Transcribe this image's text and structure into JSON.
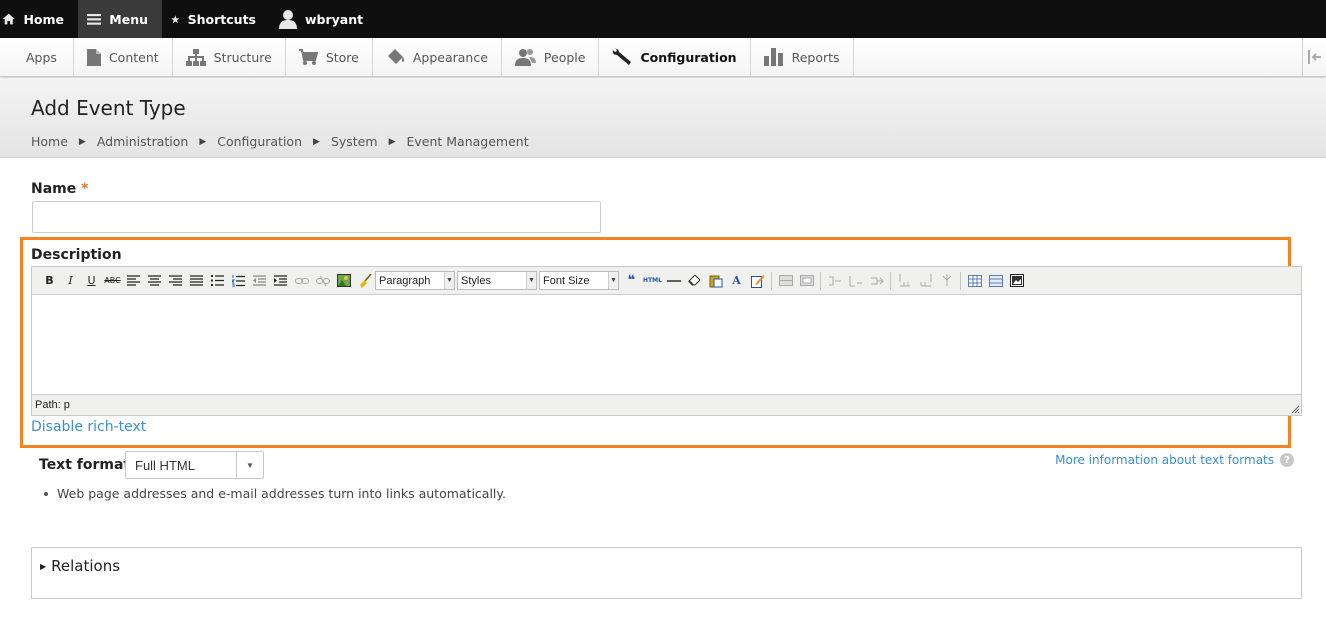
{
  "topbar": {
    "home": "Home",
    "menu": "Menu",
    "shortcuts": "Shortcuts",
    "user": "wbryant"
  },
  "tray": {
    "items": [
      {
        "label": "Apps",
        "icon": "none"
      },
      {
        "label": "Content",
        "icon": "document-icon"
      },
      {
        "label": "Structure",
        "icon": "sitemap-icon"
      },
      {
        "label": "Store",
        "icon": "cart-icon"
      },
      {
        "label": "Appearance",
        "icon": "paint-icon"
      },
      {
        "label": "People",
        "icon": "people-icon"
      },
      {
        "label": "Configuration",
        "icon": "wrench-icon",
        "active": true
      },
      {
        "label": "Reports",
        "icon": "bar-chart-icon"
      }
    ]
  },
  "header": {
    "title": "Add Event Type",
    "breadcrumb": [
      "Home",
      "Administration",
      "Configuration",
      "System",
      "Event Management"
    ],
    "separator": "▶"
  },
  "form": {
    "name_label": "Name",
    "required_mark": "*",
    "name_value": "",
    "description_label": "Description",
    "editor": {
      "format_select": "Paragraph",
      "styles_select": "Styles",
      "font_size_select": "Font Size",
      "path": "Path: p"
    },
    "disable_rich_text": "Disable rich-text",
    "text_format_label": "Text format",
    "text_format_value": "Full HTML",
    "more_info": "More information about text formats",
    "tip": "Web page addresses and e-mail addresses turn into links automatically.",
    "relations_title": "Relations"
  },
  "colors": {
    "highlight": "#f58320",
    "link": "#3b8fd3",
    "topbar": "#0f0f0f"
  }
}
